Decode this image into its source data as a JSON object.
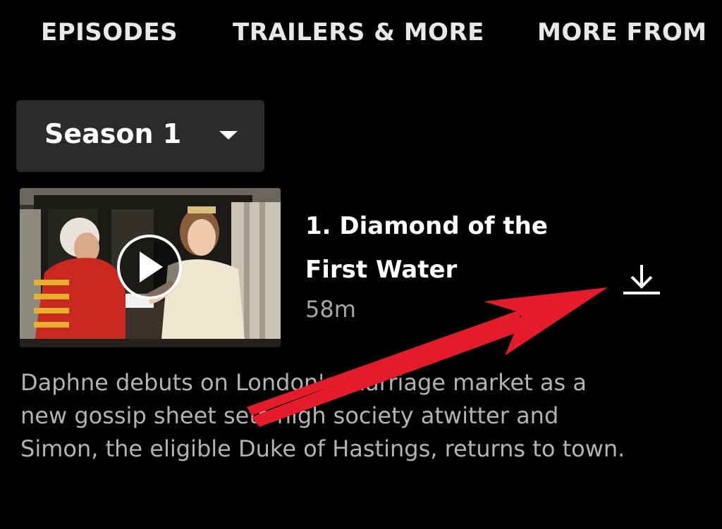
{
  "tabs": {
    "episodes": "EPISODES",
    "trailers": "TRAILERS & MORE",
    "more_from": "MORE FROM"
  },
  "season_selector": {
    "label": "Season 1",
    "caret_icon": "caret-down-icon"
  },
  "episode": {
    "title": "1. Diamond of the First Water",
    "duration": "58m",
    "play_icon": "play-icon",
    "download_icon": "download-icon",
    "description": "Daphne debuts on London's marriage market as a new gossip sheet sets high society atwitter and Simon, the eligible Duke of Hastings, returns to town."
  },
  "annotation": {
    "arrow_color": "#e31b2b",
    "arrow_icon": "red-arrow-pointer"
  },
  "colors": {
    "background": "#000000",
    "selector_bg": "#2b2b2b",
    "description_text": "#b3b3b3",
    "duration_text": "#a6a6a6"
  }
}
